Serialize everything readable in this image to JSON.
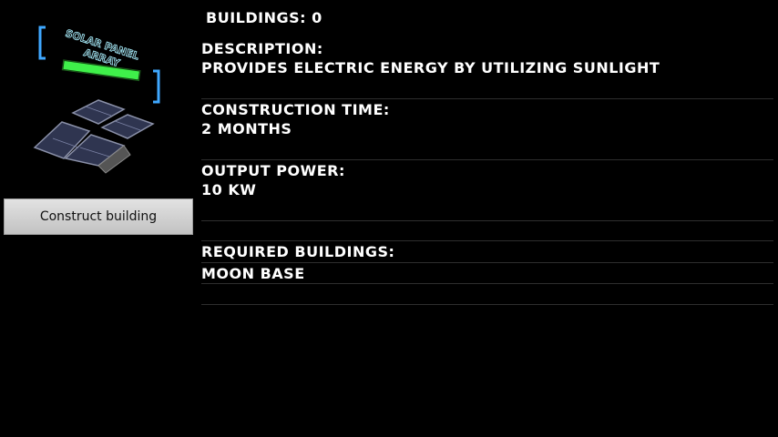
{
  "building": {
    "name_line1": "SOLAR PANEL",
    "name_line2": "ARRAY",
    "accent_color": "#3ff04a",
    "frame_color": "#3fa8ff"
  },
  "buildings_count": "BUILDINGS: 0",
  "description": {
    "label": "DESCRIPTION:",
    "value": "PROVIDES ELECTRIC ENERGY BY UTILIZING SUNLIGHT"
  },
  "construction_time": {
    "label": "CONSTRUCTION TIME:",
    "value": "2 MONTHS"
  },
  "output_power": {
    "label": "OUTPUT POWER:",
    "value": "10 KW"
  },
  "required_buildings": {
    "label": "REQUIRED BUILDINGS:",
    "value": "MOON BASE"
  },
  "construct_button": "Construct building"
}
